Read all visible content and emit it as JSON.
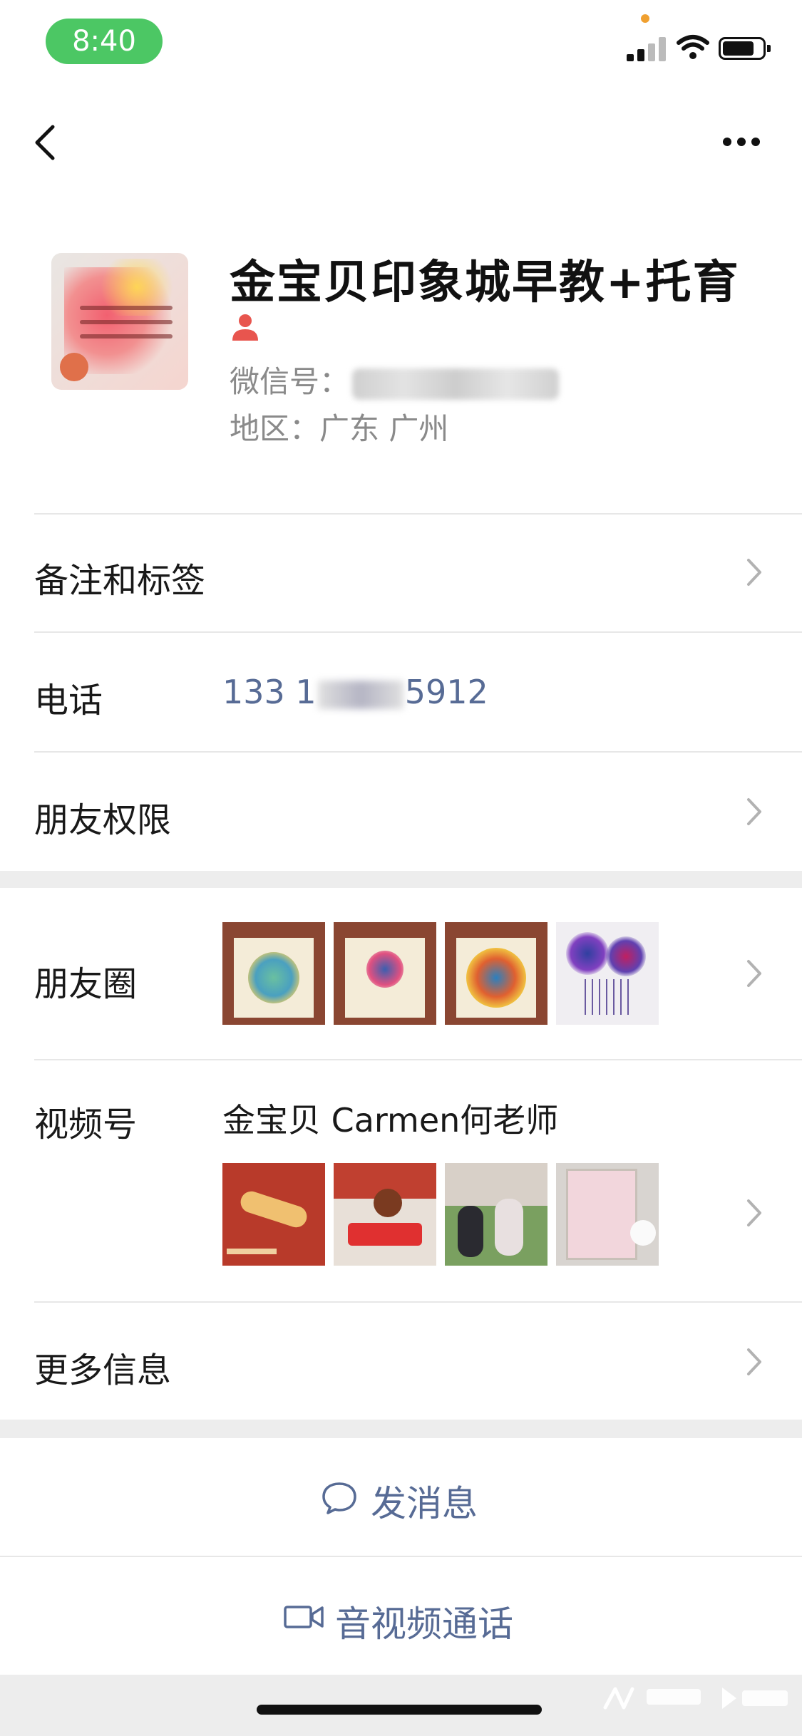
{
  "status_bar": {
    "time": "8:40",
    "battery_level": 0.8
  },
  "profile": {
    "name": "金宝贝印象城早教+托育",
    "wechat_id_label": "微信号：",
    "region_label": "地区：",
    "region_value": "广东 广州"
  },
  "rows": {
    "remarks_label": "备注和标签",
    "phone_label": "电话",
    "phone_prefix": "133 1",
    "phone_suffix": "5912",
    "friend_permissions_label": "朋友权限",
    "moments_label": "朋友圈",
    "channels_label": "视频号",
    "channels_title": "金宝贝 Carmen何老师",
    "more_info_label": "更多信息"
  },
  "actions": {
    "send_message_label": "发消息",
    "video_call_label": "音视频通话"
  },
  "colors": {
    "accent_link": "#576b95",
    "status_pill": "#4cc764",
    "background": "#ededed"
  },
  "icons": [
    "back-icon",
    "more-icon",
    "person-icon",
    "chevron-right-icon",
    "chat-bubble-icon",
    "video-camera-icon"
  ]
}
